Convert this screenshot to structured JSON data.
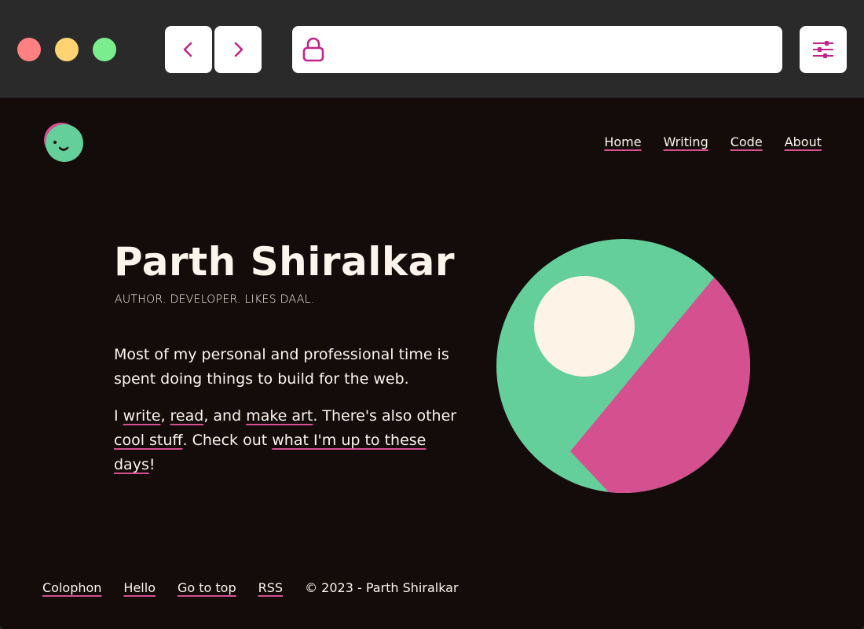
{
  "browser": {
    "url": "",
    "colors": {
      "chrome": "#2b2a2a",
      "accent": "#c0248a"
    },
    "icons": {
      "back": "chevron-left-icon",
      "forward": "chevron-right-icon",
      "lock": "lock-icon",
      "settings": "sliders-icon"
    }
  },
  "site": {
    "nav": [
      {
        "label": "Home"
      },
      {
        "label": "Writing"
      },
      {
        "label": "Code"
      },
      {
        "label": "About"
      }
    ],
    "hero": {
      "name": "Parth Shiralkar",
      "tagline": "AUTHOR. DEVELOPER. LIKES DAAL.",
      "para1": "Most of my personal and professional time is spent doing things to build for the web.",
      "para2": {
        "t1": "I ",
        "write": "write",
        "t2": ", ",
        "read": "read",
        "t3": ", and ",
        "make_art": "make art",
        "t4": ". There's also other ",
        "cool_stuff": "cool stuff",
        "t5": ". Check out ",
        "now": "what I'm up to these days",
        "t6": "!"
      }
    },
    "footer": {
      "links": [
        {
          "label": "Colophon"
        },
        {
          "label": "Hello"
        },
        {
          "label": "Go to top"
        },
        {
          "label": "RSS"
        }
      ],
      "copyright": "© 2023 - Parth Shiralkar"
    },
    "colors": {
      "background": "#140b0b",
      "text": "#fdf4ec",
      "green": "#64cf9a",
      "pink": "#d4508f",
      "cream": "#fdf3e6"
    }
  }
}
